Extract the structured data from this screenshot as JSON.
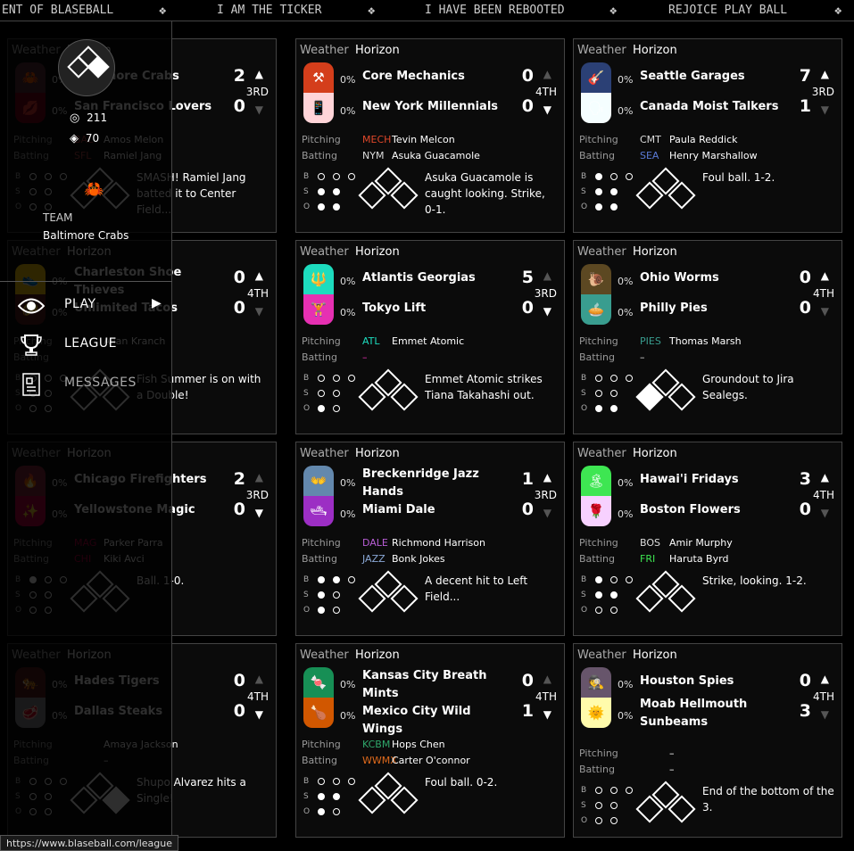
{
  "ticker": {
    "items": [
      "ENT OF BLASEBALL",
      "I AM THE TICKER",
      "I HAVE BEEN REBOOTED",
      "REJOICE PLAY BALL"
    ],
    "separator": "❖"
  },
  "labels": {
    "weather": "Weather",
    "pitching": "Pitching",
    "batting": "Batting",
    "b": "B",
    "s": "S",
    "o": "O"
  },
  "games": [
    {
      "weather": "Horizon",
      "away": {
        "name": "Baltimore Crabs",
        "pct": "0%",
        "score": "2",
        "emoji": "🦀",
        "color": "#593037"
      },
      "home": {
        "name": "San Francisco Lovers",
        "pct": "0%",
        "score": "0",
        "emoji": "💋",
        "color": "#780018"
      },
      "inning": "3RD",
      "top": true,
      "pitching": {
        "abbr": "BAL",
        "abbr_color": "#a44",
        "name": "Amos Melon"
      },
      "batting": {
        "abbr": "SFL",
        "abbr_color": "#a44",
        "name": "Ramiel Jang"
      },
      "balls": 0,
      "strikes": 0,
      "outs": 0,
      "bases": [
        false,
        false,
        false
      ],
      "message": "SMASH! Ramiel Jang batted it to Center Field..."
    },
    {
      "weather": "Horizon",
      "away": {
        "name": "Core Mechanics",
        "pct": "0%",
        "score": "0",
        "emoji": "⚒",
        "color": "#d43e1b"
      },
      "home": {
        "name": "New York Millennials",
        "pct": "0%",
        "score": "0",
        "emoji": "📱",
        "color": "#ffd4d8"
      },
      "inning": "4TH",
      "top": false,
      "pitching": {
        "abbr": "MECH",
        "abbr_color": "#e0482a",
        "name": "Tevin Melcon"
      },
      "batting": {
        "abbr": "NYM",
        "abbr_color": "#dddddd",
        "name": "Asuka Guacamole"
      },
      "balls": 0,
      "strikes": 2,
      "outs": 2,
      "bases": [
        false,
        false,
        false
      ],
      "message": "Asuka Guacamole is caught looking. Strike, 0-1."
    },
    {
      "weather": "Horizon",
      "away": {
        "name": "Seattle Garages",
        "pct": "0%",
        "score": "7",
        "emoji": "🎸",
        "color": "#2b4075"
      },
      "home": {
        "name": "Canada Moist Talkers",
        "pct": "0%",
        "score": "1",
        "emoji": "🗣",
        "color": "#f5feff"
      },
      "inning": "3RD",
      "top": true,
      "pitching": {
        "abbr": "CMT",
        "abbr_color": "#dddddd",
        "name": "Paula Reddick"
      },
      "batting": {
        "abbr": "SEA",
        "abbr_color": "#5a7ad6",
        "name": "Henry Marshallow"
      },
      "balls": 1,
      "strikes": 2,
      "outs": 2,
      "bases": [
        false,
        false,
        false
      ],
      "message": "Foul ball. 1-2."
    },
    {
      "weather": "Horizon",
      "away": {
        "name": "Charleston Shoe Thieves",
        "pct": "0%",
        "score": "0",
        "emoji": "👟",
        "color": "#ffce0a"
      },
      "home": {
        "name": "Unlimited Tacos",
        "pct": "0%",
        "score": "0",
        "emoji": "🌮",
        "color": "#5c1c1c"
      },
      "inning": "4TH",
      "top": true,
      "pitching": {
        "abbr": "",
        "abbr_color": "#dddddd",
        "name": "Allan Kranch"
      },
      "batting": {
        "abbr": "",
        "abbr_color": "#dddddd",
        "name": ""
      },
      "balls": 0,
      "strikes": 0,
      "outs": 0,
      "bases": [
        false,
        false,
        false
      ],
      "message": "Fish Summer is on with a Double!"
    },
    {
      "weather": "Horizon",
      "away": {
        "name": "Atlantis Georgias",
        "pct": "0%",
        "score": "5",
        "emoji": "🔱",
        "color": "#1ddcbe"
      },
      "home": {
        "name": "Tokyo Lift",
        "pct": "0%",
        "score": "0",
        "emoji": "🏋",
        "color": "#e630b2"
      },
      "inning": "3RD",
      "top": false,
      "pitching": {
        "abbr": "ATL",
        "abbr_color": "#1ddcbe",
        "name": "Emmet Atomic"
      },
      "batting": {
        "abbr": "–",
        "abbr_color": "#e630b2",
        "name": ""
      },
      "balls": 0,
      "strikes": 0,
      "outs": 1,
      "bases": [
        false,
        false,
        false
      ],
      "message": "Emmet Atomic strikes Tiana Takahashi out."
    },
    {
      "weather": "Horizon",
      "away": {
        "name": "Ohio Worms",
        "pct": "0%",
        "score": "0",
        "emoji": "🐌",
        "color": "#5c4822"
      },
      "home": {
        "name": "Philly Pies",
        "pct": "0%",
        "score": "0",
        "emoji": "🥧",
        "color": "#399d8f"
      },
      "inning": "4TH",
      "top": true,
      "pitching": {
        "abbr": "PIES",
        "abbr_color": "#399d8f",
        "name": "Thomas Marsh"
      },
      "batting": {
        "abbr": "–",
        "abbr_color": "#dddddd",
        "name": ""
      },
      "balls": 0,
      "strikes": 0,
      "outs": 2,
      "bases": [
        true,
        false,
        false
      ],
      "message": "Groundout to Jira Sealegs."
    },
    {
      "weather": "Horizon",
      "away": {
        "name": "Chicago Firefighters",
        "pct": "0%",
        "score": "2",
        "emoji": "🔥",
        "color": "#8c2a3e"
      },
      "home": {
        "name": "Yellowstone Magic",
        "pct": "0%",
        "score": "0",
        "emoji": "✨",
        "color": "#bf0043"
      },
      "inning": "3RD",
      "top": false,
      "pitching": {
        "abbr": "MAG",
        "abbr_color": "#bf0043",
        "name": "Parker Parra"
      },
      "batting": {
        "abbr": "CHI",
        "abbr_color": "#bf0043",
        "name": "Kiki Avci"
      },
      "balls": 1,
      "strikes": 0,
      "outs": 0,
      "bases": [
        false,
        false,
        false
      ],
      "message": "Ball. 1-0."
    },
    {
      "weather": "Horizon",
      "away": {
        "name": "Breckenridge Jazz Hands",
        "pct": "0%",
        "score": "1",
        "emoji": "👐",
        "color": "#6388ad"
      },
      "home": {
        "name": "Miami Dale",
        "pct": "0%",
        "score": "0",
        "emoji": "🛥",
        "color": "#9c2ec4"
      },
      "inning": "3RD",
      "top": true,
      "pitching": {
        "abbr": "DALE",
        "abbr_color": "#b95ed6",
        "name": "Richmond Harrison"
      },
      "batting": {
        "abbr": "JAZZ",
        "abbr_color": "#8aa8d6",
        "name": "Bonk Jokes"
      },
      "balls": 2,
      "strikes": 1,
      "outs": 1,
      "bases": [
        false,
        false,
        false
      ],
      "message": "A decent hit to Left Field..."
    },
    {
      "weather": "Horizon",
      "away": {
        "name": "Hawai'i Fridays",
        "pct": "0%",
        "score": "3",
        "emoji": "🏝",
        "color": "#3ee652"
      },
      "home": {
        "name": "Boston Flowers",
        "pct": "0%",
        "score": "0",
        "emoji": "🌹",
        "color": "#f7d1ff"
      },
      "inning": "4TH",
      "top": true,
      "pitching": {
        "abbr": "BOS",
        "abbr_color": "#dddddd",
        "name": "Amir Murphy"
      },
      "batting": {
        "abbr": "FRI",
        "abbr_color": "#3ee652",
        "name": "Haruta Byrd"
      },
      "balls": 1,
      "strikes": 2,
      "outs": 0,
      "bases": [
        false,
        false,
        false
      ],
      "message": "Strike, looking. 1-2."
    },
    {
      "weather": "Horizon",
      "away": {
        "name": "Hades Tigers",
        "pct": "0%",
        "score": "0",
        "emoji": "🐅",
        "color": "#5c1c1c"
      },
      "home": {
        "name": "Dallas Steaks",
        "pct": "0%",
        "score": "0",
        "emoji": "🥩",
        "color": "#8c8d8f"
      },
      "inning": "4TH",
      "top": false,
      "pitching": {
        "abbr": "",
        "abbr_color": "#dddddd",
        "name": "Amaya Jackson"
      },
      "batting": {
        "abbr": "",
        "abbr_color": "#dddddd",
        "name": "–"
      },
      "balls": 0,
      "strikes": 0,
      "outs": 0,
      "bases": [
        false,
        false,
        true
      ],
      "message": "Shupo Alvarez hits a Single!"
    },
    {
      "weather": "Horizon",
      "away": {
        "name": "Kansas City Breath Mints",
        "pct": "0%",
        "score": "0",
        "emoji": "🍬",
        "color": "#178f55"
      },
      "home": {
        "name": "Mexico City Wild Wings",
        "pct": "0%",
        "score": "1",
        "emoji": "🍗",
        "color": "#d15700"
      },
      "inning": "4TH",
      "top": false,
      "pitching": {
        "abbr": "KCBM",
        "abbr_color": "#2fa86b",
        "name": "Hops Chen"
      },
      "batting": {
        "abbr": "WWMX",
        "abbr_color": "#e06a1c",
        "name": "Carter O'connor"
      },
      "balls": 0,
      "strikes": 2,
      "outs": 1,
      "bases": [
        false,
        false,
        false
      ],
      "message": "Foul ball. 0-2."
    },
    {
      "weather": "Horizon",
      "away": {
        "name": "Houston Spies",
        "pct": "0%",
        "score": "0",
        "emoji": "🕵",
        "color": "#67556b"
      },
      "home": {
        "name": "Moab Hellmouth Sunbeams",
        "pct": "0%",
        "score": "3",
        "emoji": "🌞",
        "color": "#fffbab"
      },
      "inning": "4TH",
      "top": true,
      "pitching": {
        "abbr": "",
        "abbr_color": "#dddddd",
        "name": "–"
      },
      "batting": {
        "abbr": "",
        "abbr_color": "#dddddd",
        "name": "–"
      },
      "balls": 0,
      "strikes": 0,
      "outs": 0,
      "bases": [
        false,
        false,
        false
      ],
      "message": "End of the bottom of the 3."
    }
  ],
  "overlay": {
    "coins": "211",
    "votes": "70",
    "coin_icon": "coin-icon",
    "vote_icon": "vote-diamond-icon",
    "team_emoji": "🦀",
    "team_label": "TEAM",
    "team_name": "Baltimore Crabs",
    "nav": [
      {
        "label": "PLAY",
        "icon": "eye-icon",
        "active": true
      },
      {
        "label": "LEAGUE",
        "icon": "trophy-icon",
        "active": true
      },
      {
        "label": "MESSAGES",
        "icon": "message-icon",
        "active": false
      }
    ]
  },
  "status_bar": {
    "url": "https://www.blaseball.com/league"
  }
}
